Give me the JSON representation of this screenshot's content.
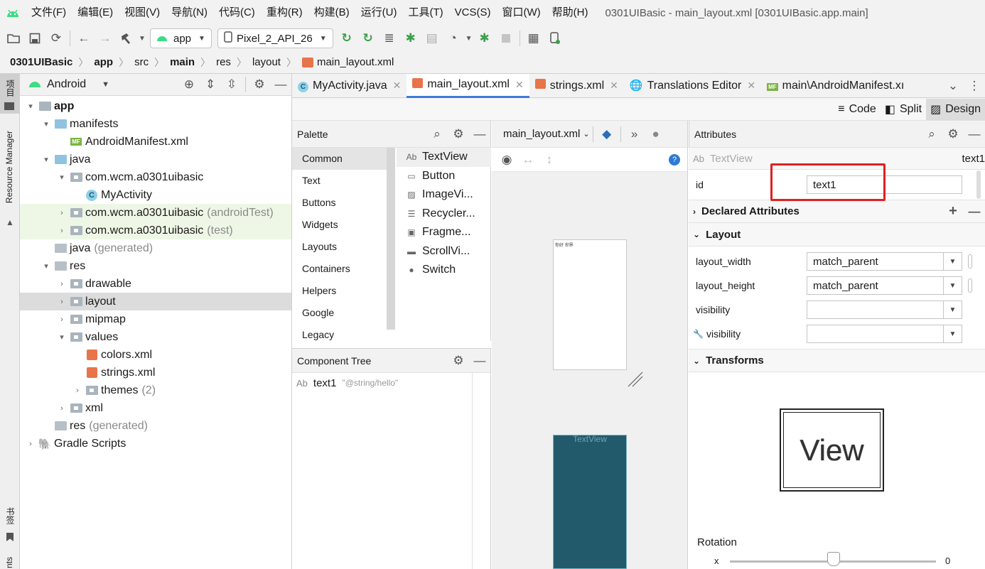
{
  "menu": {
    "items": [
      "文件(F)",
      "编辑(E)",
      "视图(V)",
      "导航(N)",
      "代码(C)",
      "重构(R)",
      "构建(B)",
      "运行(U)",
      "工具(T)",
      "VCS(S)",
      "窗口(W)",
      "帮助(H)"
    ],
    "window_title": "0301UIBasic - main_layout.xml [0301UIBasic.app.main]"
  },
  "toolbar": {
    "run_config": "app",
    "device": "Pixel_2_API_26"
  },
  "breadcrumb": [
    "0301UIBasic",
    "app",
    "src",
    "main",
    "res",
    "layout",
    "main_layout.xml"
  ],
  "left_strip": {
    "project_label": "项目",
    "resource_manager_label": "Resource Manager",
    "bookmarks_label": "书签",
    "bottom_label": "nts"
  },
  "project_panel": {
    "view_mode": "Android",
    "tree": [
      {
        "label": "app",
        "suffix": "",
        "level": 0,
        "arrow": "▾",
        "icon": "app-folder-icon",
        "bold": true
      },
      {
        "label": "manifests",
        "suffix": "",
        "level": 1,
        "arrow": "▾",
        "icon": "folder-icon"
      },
      {
        "label": "AndroidManifest.xml",
        "suffix": "",
        "level": 2,
        "arrow": "",
        "icon": "manifest-file-icon"
      },
      {
        "label": "java",
        "suffix": "",
        "level": 1,
        "arrow": "▾",
        "icon": "folder-icon"
      },
      {
        "label": "com.wcm.a0301uibasic",
        "suffix": "",
        "level": 2,
        "arrow": "▾",
        "icon": "package-icon"
      },
      {
        "label": "MyActivity",
        "suffix": "",
        "level": 3,
        "arrow": "",
        "icon": "class-icon"
      },
      {
        "label": "com.wcm.a0301uibasic",
        "suffix": "(androidTest)",
        "level": 2,
        "arrow": "›",
        "icon": "package-icon",
        "green": true
      },
      {
        "label": "com.wcm.a0301uibasic",
        "suffix": "(test)",
        "level": 2,
        "arrow": "›",
        "icon": "package-icon",
        "green": true
      },
      {
        "label": "java",
        "suffix": "(generated)",
        "level": 1,
        "arrow": "",
        "icon": "generated-folder-icon"
      },
      {
        "label": "res",
        "suffix": "",
        "level": 1,
        "arrow": "▾",
        "icon": "res-folder-icon"
      },
      {
        "label": "drawable",
        "suffix": "",
        "level": 2,
        "arrow": "›",
        "icon": "package-icon"
      },
      {
        "label": "layout",
        "suffix": "",
        "level": 2,
        "arrow": "›",
        "icon": "package-icon",
        "selected": true
      },
      {
        "label": "mipmap",
        "suffix": "",
        "level": 2,
        "arrow": "›",
        "icon": "package-icon"
      },
      {
        "label": "values",
        "suffix": "",
        "level": 2,
        "arrow": "▾",
        "icon": "package-icon"
      },
      {
        "label": "colors.xml",
        "suffix": "",
        "level": 3,
        "arrow": "",
        "icon": "xml-file-icon"
      },
      {
        "label": "strings.xml",
        "suffix": "",
        "level": 3,
        "arrow": "",
        "icon": "xml-file-icon"
      },
      {
        "label": "themes",
        "suffix": "(2)",
        "level": 3,
        "arrow": "›",
        "icon": "package-icon"
      },
      {
        "label": "xml",
        "suffix": "",
        "level": 2,
        "arrow": "›",
        "icon": "package-icon"
      },
      {
        "label": "res",
        "suffix": "(generated)",
        "level": 1,
        "arrow": "",
        "icon": "res-folder-icon"
      },
      {
        "label": "Gradle Scripts",
        "suffix": "",
        "level": 0,
        "arrow": "›",
        "icon": "gradle-icon"
      }
    ]
  },
  "editor_tabs": [
    {
      "label": "MyActivity.java",
      "icon": "class-icon",
      "closable": true,
      "active": false
    },
    {
      "label": "main_layout.xml",
      "icon": "xml-file-icon",
      "closable": true,
      "active": true
    },
    {
      "label": "strings.xml",
      "icon": "xml-file-icon",
      "closable": true,
      "active": false
    },
    {
      "label": "Translations Editor",
      "icon": "globe-icon",
      "closable": true,
      "active": false
    },
    {
      "label": "main\\AndroidManifest.xı",
      "icon": "manifest-file-icon",
      "closable": false,
      "active": false
    }
  ],
  "view_modes": {
    "code": "Code",
    "split": "Split",
    "design": "Design"
  },
  "palette": {
    "title": "Palette",
    "categories": [
      "Common",
      "Text",
      "Buttons",
      "Widgets",
      "Layouts",
      "Containers",
      "Helpers",
      "Google",
      "Legacy"
    ],
    "selected_category": "Common",
    "items": [
      {
        "label": "TextView",
        "icon": "textview-icon",
        "glyph": "Ab"
      },
      {
        "label": "Button",
        "icon": "button-icon",
        "glyph": "▭"
      },
      {
        "label": "ImageVi...",
        "icon": "imageview-icon",
        "glyph": "▨"
      },
      {
        "label": "Recycler...",
        "icon": "recyclerview-icon",
        "glyph": "☰"
      },
      {
        "label": "Fragme...",
        "icon": "fragment-icon",
        "glyph": "▣"
      },
      {
        "label": "ScrollVi...",
        "icon": "scrollview-icon",
        "glyph": "▬"
      },
      {
        "label": "Switch",
        "icon": "switch-icon",
        "glyph": "●"
      }
    ]
  },
  "component_tree": {
    "title": "Component Tree",
    "items": [
      {
        "glyph": "Ab",
        "label": "text1",
        "hint": "\"@string/hello\""
      }
    ]
  },
  "design": {
    "file": "main_layout.xml",
    "blueprint_label": "TextView",
    "preview_text": "你好 世界",
    "blueprint_color": "#235a6b"
  },
  "attributes": {
    "title": "Attributes",
    "component_glyph": "Ab",
    "component_type": "TextView",
    "component_id_short": "text1",
    "id_label": "id",
    "id_value": "text1",
    "highlight_color": "#e02020",
    "sections": {
      "declared": "Declared Attributes",
      "layout": "Layout",
      "transforms": "Transforms"
    },
    "layout_rows": [
      {
        "label": "layout_width",
        "value": "match_parent"
      },
      {
        "label": "layout_height",
        "value": "match_parent"
      },
      {
        "label": "visibility",
        "value": ""
      },
      {
        "label": "visibility",
        "value": "",
        "wrench": true
      }
    ],
    "view_box_label": "View",
    "rotation_label": "Rotation",
    "rotation_axis": "x",
    "rotation_value": "0"
  }
}
